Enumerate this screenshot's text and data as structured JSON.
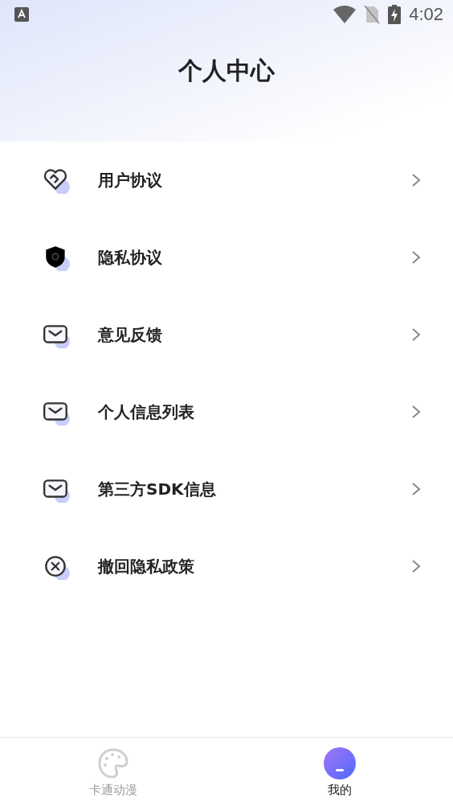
{
  "status_bar": {
    "time": "4:02"
  },
  "title": "个人中心",
  "menu": [
    {
      "label": "用户协议",
      "kind": "heart"
    },
    {
      "label": "隐私协议",
      "kind": "shield"
    },
    {
      "label": "意见反馈",
      "kind": "mail"
    },
    {
      "label": "个人信息列表",
      "kind": "mail"
    },
    {
      "label": "第三方SDK信息",
      "kind": "mail"
    },
    {
      "label": "撤回隐私政策",
      "kind": "cancel"
    }
  ],
  "tab_bar": [
    {
      "label": "卡通动漫",
      "kind": "palette",
      "selected": false
    },
    {
      "label": "我的",
      "kind": "avatar",
      "selected": true
    }
  ]
}
